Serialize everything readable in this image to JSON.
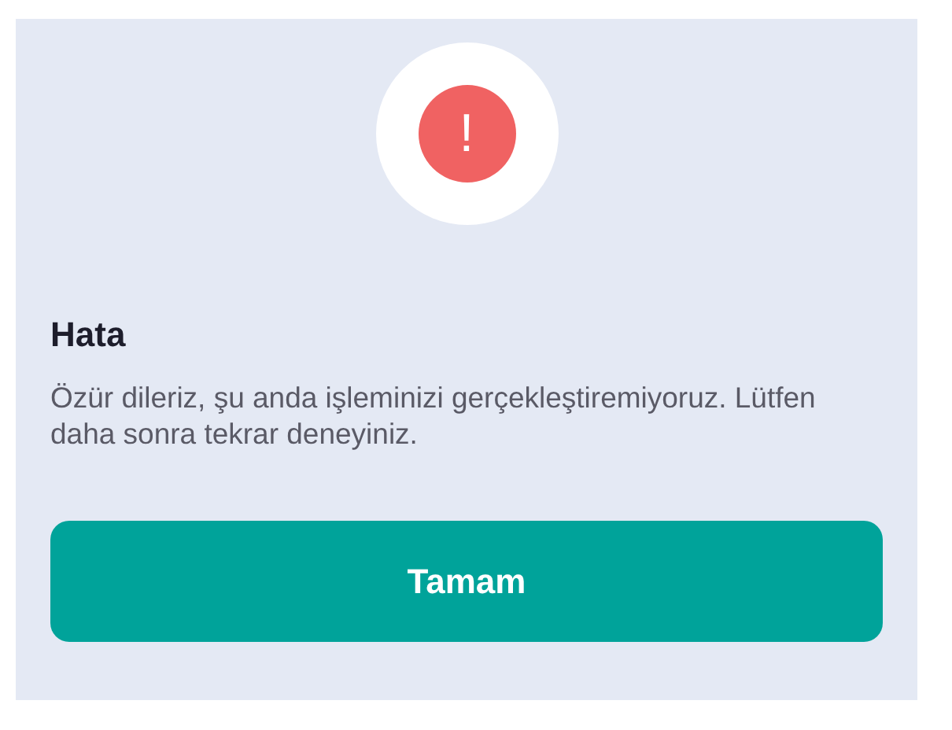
{
  "dialog": {
    "icon_glyph": "!",
    "title": "Hata",
    "message": "Özür dileriz, şu anda işleminizi gerçekleştiremiyoruz. Lütfen daha sonra tekrar deneyiniz.",
    "button": "Tamam"
  }
}
